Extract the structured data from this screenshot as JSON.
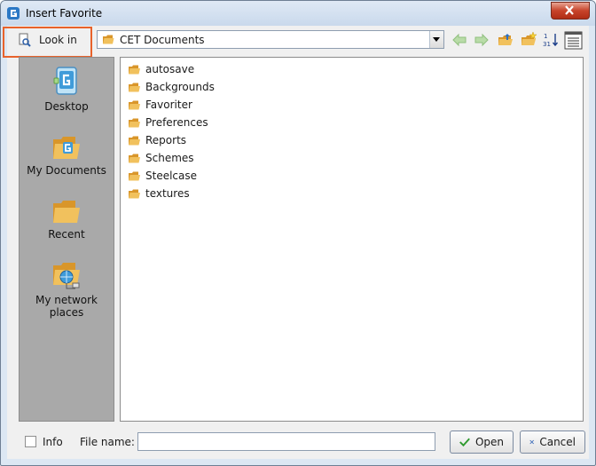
{
  "window": {
    "title": "Insert Favorite"
  },
  "toolbar": {
    "look_in_label": "Look in",
    "look_in_value": "CET Documents"
  },
  "places": [
    {
      "label": "Desktop",
      "icon": "desktop-icon"
    },
    {
      "label": "My Documents",
      "icon": "my-documents-icon"
    },
    {
      "label": "Recent",
      "icon": "recent-folder-icon"
    },
    {
      "label": "My network places",
      "icon": "network-places-icon"
    }
  ],
  "files": [
    "autosave",
    "Backgrounds",
    "Favoriter",
    "Preferences",
    "Reports",
    "Schemes",
    "Steelcase",
    "textures"
  ],
  "bottom": {
    "info_label": "Info",
    "file_name_label": "File name:",
    "file_name_value": "",
    "open_label": "Open",
    "cancel_label": "Cancel"
  },
  "colors": {
    "highlight": "#e8622b",
    "places_bg": "#a9a9a9",
    "folder": "#e8b04b"
  }
}
